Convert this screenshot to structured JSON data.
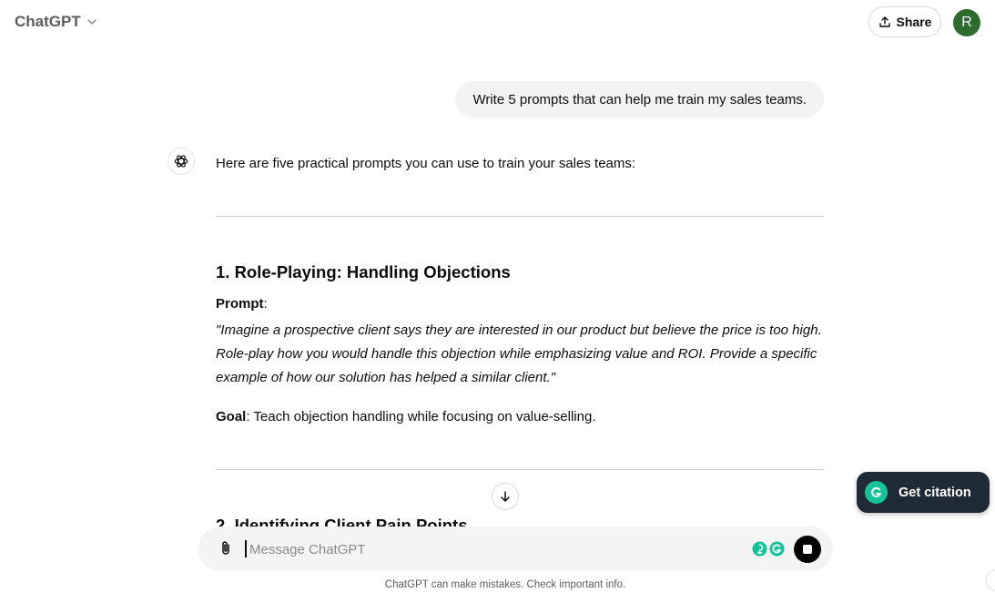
{
  "header": {
    "model_name": "ChatGPT",
    "share_label": "Share",
    "avatar_initial": "R"
  },
  "conversation": {
    "user_message": "Write 5 prompts that can help me train my sales teams.",
    "assistant": {
      "intro": "Here are five practical prompts you can use to train your sales teams:",
      "section1": {
        "heading": "1. Role-Playing: Handling Objections",
        "prompt_label": "Prompt",
        "prompt_suffix": ":",
        "prompt_text": "\"Imagine a prospective client says they are interested in our product but believe the price is too high. Role-play how you would handle this objection while emphasizing value and ROI. Provide a specific example of how our solution has helped a similar client.\"",
        "goal_label": "Goal",
        "goal_text": ": Teach objection handling while focusing on value-selling."
      },
      "section2": {
        "heading": "2. Identifying Client Pain Points"
      }
    }
  },
  "composer": {
    "placeholder": "Message ChatGPT"
  },
  "footer_note": "ChatGPT can make mistakes. Check important info.",
  "citation_button": {
    "label": "Get citation"
  },
  "icons": [
    "chevron-down-icon",
    "share-icon",
    "openai-logo-icon",
    "arrow-down-icon",
    "paperclip-icon",
    "grammarly-icon",
    "stop-icon"
  ],
  "colors": {
    "avatar_bg": "#2e6b2e",
    "citation_bg": "#1f2a37",
    "grammarly_green": "#15c39a",
    "composer_bg": "#f4f4f4",
    "bubble_bg": "#f3f3f3"
  }
}
